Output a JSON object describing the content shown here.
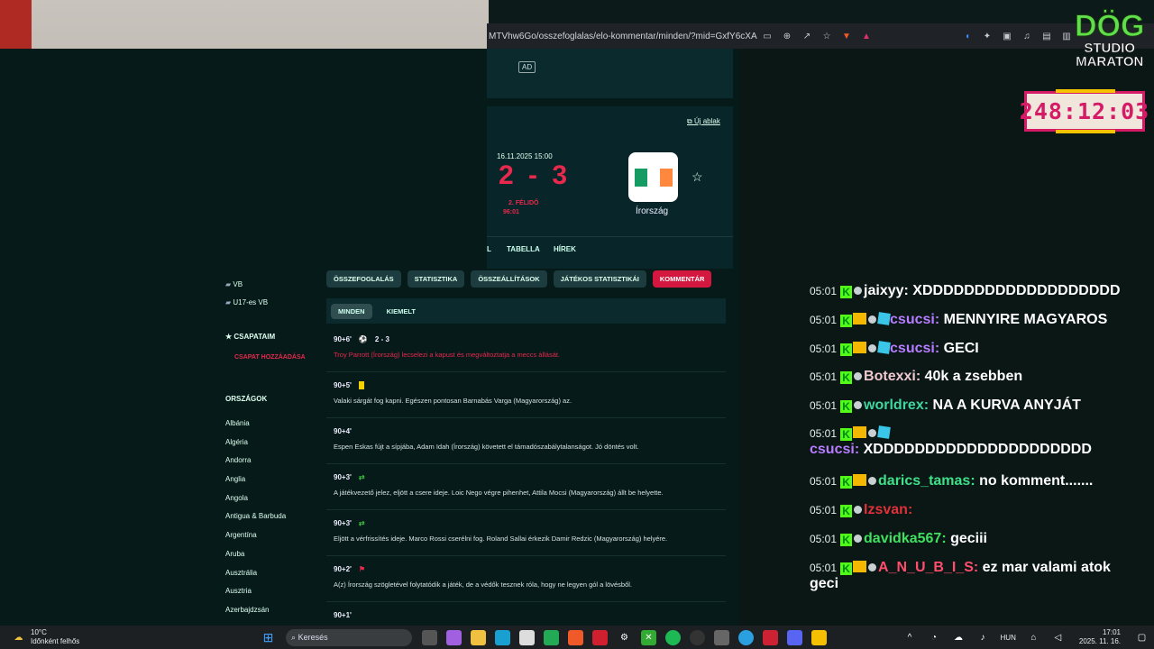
{
  "browser": {
    "url": "MTVhw6Go/osszefoglalas/elo-kommentar/minden/?mid=GxfY6cXA"
  },
  "ad": {
    "label": "AD"
  },
  "match": {
    "new_window": "Új ablak",
    "date": "16.11.2025 15:00",
    "score": "2 - 3",
    "half": "2. FÉLIDŐ",
    "time": "96:01",
    "team": "Írország",
    "tabs": [
      "L",
      "TABELLA",
      "HÍREK"
    ]
  },
  "pills": [
    "ÖSSZEFOGLALÁS",
    "STATISZTIKA",
    "ÖSSZEÁLLÍTÁSOK",
    "JÁTÉKOS STATISZTIKÁI",
    "KOMMENTÁR"
  ],
  "subtabs": [
    "MINDEN",
    "KIEMELT"
  ],
  "comments": [
    {
      "minute": "90+6'",
      "extra": "2 - 3",
      "text": "Troy Parrott (Írország) lecselezi a kapust és megváltoztatja a meccs állását.",
      "red": true
    },
    {
      "minute": "90+5'",
      "extra": "",
      "text": "Valaki sárgát fog kapni. Egészen pontosan Barnabás Varga (Magyarország) az.",
      "red": false
    },
    {
      "minute": "90+4'",
      "extra": "",
      "text": "Espen Eskas fújt a sípjába, Adam Idah (Írország) követett el támadószabálytalanságot. Jó döntés volt.",
      "red": false
    },
    {
      "minute": "90+3'",
      "extra": "",
      "text": "A játékvezető jelez, eljött a csere ideje. Loic Nego végre pihenhet, Attila Mocsi (Magyarország) állt be helyette.",
      "red": false
    },
    {
      "minute": "90+3'",
      "extra": "",
      "text": "Eljött a vérfrissítés ideje. Marco Rossi cserélni fog. Roland Sallai érkezik Damir Redzic (Magyarország) helyére.",
      "red": false
    },
    {
      "minute": "90+2'",
      "extra": "",
      "text": "A(z) Írország szögletével folytatódik a játék, de a védők tesznek róla, hogy ne legyen gól a lövésből.",
      "red": false
    },
    {
      "minute": "90+1'",
      "extra": "",
      "text": "",
      "red": false
    }
  ],
  "sidebar": {
    "competitions": [
      "VB",
      "U17-es VB"
    ],
    "my_teams": "CSAPATAIM",
    "add_team": "CSAPAT HOZZÁADÁSA",
    "countries_heading": "ORSZÁGOK",
    "countries": [
      "Albánia",
      "Algéria",
      "Andorra",
      "Anglia",
      "Angola",
      "Antigua & Barbuda",
      "Argentína",
      "Aruba",
      "Ausztrália",
      "Ausztria",
      "Azerbajdzsán"
    ]
  },
  "overlay": {
    "logo1": "DÖG",
    "logo2": "STUDIO",
    "logo3": "MARATON",
    "timer": "248:12:03"
  },
  "chat": [
    {
      "time": "05:01",
      "user": "jaixyy",
      "color": "#ffffff",
      "msg": "XDDDDDDDDDDDDDDDDDDD",
      "badges": [
        "k",
        "dot"
      ]
    },
    {
      "time": "05:01",
      "user": "csucsi",
      "color": "#b77cff",
      "msg": "MENNYIRE MAGYAROS",
      "badges": [
        "k",
        "crown",
        "dot",
        "cube"
      ]
    },
    {
      "time": "05:01",
      "user": "csucsi",
      "color": "#b77cff",
      "msg": "GECI",
      "badges": [
        "k",
        "crown",
        "dot",
        "cube"
      ]
    },
    {
      "time": "05:01",
      "user": "Botexxi",
      "color": "#f0c8d0",
      "msg": "40k a zsebben",
      "badges": [
        "k",
        "dot"
      ]
    },
    {
      "time": "05:01",
      "user": "worldrex",
      "color": "#3fd6a0",
      "msg": "NA A KURVA ANYJÁT",
      "badges": [
        "k",
        "dot"
      ]
    },
    {
      "time": "05:01",
      "user": "csucsi",
      "color": "#b77cff",
      "msg": "XDDDDDDDDDDDDDDDDDDDDD",
      "badges": [
        "k",
        "crown",
        "dot",
        "cube"
      ]
    },
    {
      "time": "05:01",
      "user": "darics_tamas",
      "color": "#3fe08a",
      "msg": "no komment.......",
      "badges": [
        "k",
        "crown",
        "dot"
      ]
    },
    {
      "time": "05:01",
      "user": "Izsvan",
      "color": "#e0303a",
      "msg": "",
      "badges": [
        "k",
        "dot"
      ]
    },
    {
      "time": "05:01",
      "user": "davidka567",
      "color": "#3fe060",
      "msg": "geciii",
      "badges": [
        "k",
        "dot"
      ]
    },
    {
      "time": "05:01",
      "user": "A_N_U_B_I_S",
      "color": "#ff4d6d",
      "msg": "ez mar valami atok",
      "msg2": "geci",
      "badges": [
        "k",
        "crown",
        "dot"
      ]
    }
  ],
  "taskbar": {
    "temp": "10°C",
    "weather": "Időnként felhős",
    "search": "Keresés",
    "lang": "HUN",
    "clock": "17:01",
    "date": "2025. 11. 16."
  }
}
